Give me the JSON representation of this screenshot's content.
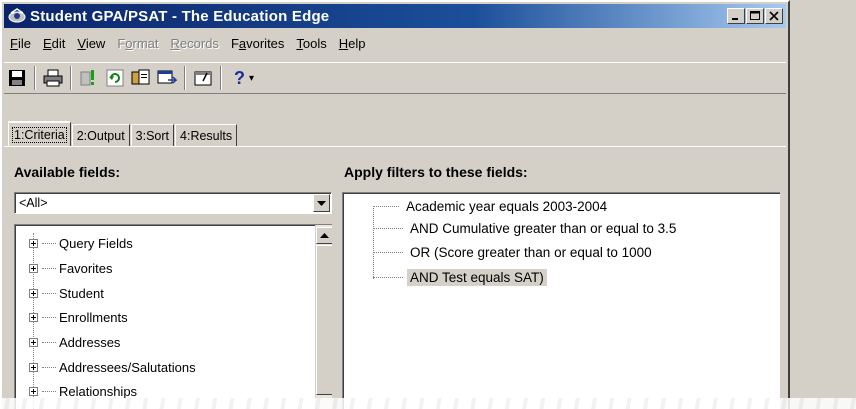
{
  "window": {
    "title": "Student GPA/PSAT - The Education Edge",
    "controls": {
      "minimize": "_",
      "maximize": "□",
      "close": "×"
    }
  },
  "menu": [
    {
      "label": "File",
      "enabled": true
    },
    {
      "label": "Edit",
      "enabled": true
    },
    {
      "label": "View",
      "enabled": true
    },
    {
      "label": "Format",
      "enabled": false
    },
    {
      "label": "Records",
      "enabled": false
    },
    {
      "label": "Favorites",
      "enabled": true
    },
    {
      "label": "Tools",
      "enabled": true
    },
    {
      "label": "Help",
      "enabled": true
    }
  ],
  "toolbar": {
    "buttons": [
      "save-icon",
      "print-icon",
      "query-icon",
      "refresh-icon",
      "copy-icon",
      "export-icon",
      "properties-icon",
      "help-icon"
    ],
    "help_label": "?",
    "help_dropdown": "▾"
  },
  "tabs": [
    {
      "label": "1:Criteria",
      "active": true
    },
    {
      "label": "2:Output",
      "active": false
    },
    {
      "label": "3:Sort",
      "active": false
    },
    {
      "label": "4:Results",
      "active": false
    }
  ],
  "available_fields": {
    "heading": "Available fields:",
    "filter_value": "<All>",
    "items": [
      "Query Fields",
      "Favorites",
      "Student",
      "Enrollments",
      "Addresses",
      "Addressees/Salutations",
      "Relationships"
    ]
  },
  "filters": {
    "heading": "Apply filters to these fields:",
    "rows": [
      {
        "text": "Academic year equals 2003-2004",
        "selected": false
      },
      {
        "text": "AND Cumulative greater than or equal to 3.5",
        "selected": false
      },
      {
        "text": "OR (Score greater than or equal to 1000",
        "selected": false
      },
      {
        "text": "AND Test equals SAT)",
        "selected": true
      }
    ]
  },
  "colors": {
    "titlebar_start": "#0a246a",
    "titlebar_end": "#a6caf0",
    "face": "#d4d0c8"
  }
}
